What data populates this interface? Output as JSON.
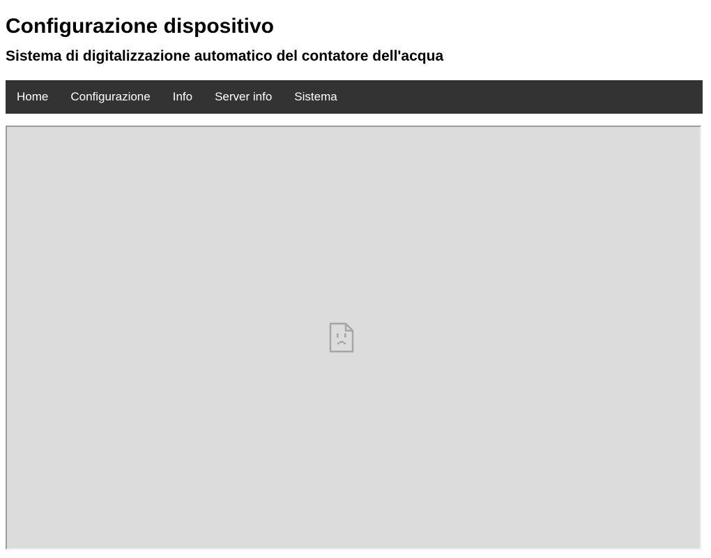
{
  "header": {
    "title": "Configurazione dispositivo",
    "subtitle": "Sistema di digitalizzazione automatico del contatore dell'acqua"
  },
  "nav": {
    "items": [
      {
        "label": "Home"
      },
      {
        "label": "Configurazione"
      },
      {
        "label": "Info"
      },
      {
        "label": "Server info"
      },
      {
        "label": "Sistema"
      }
    ],
    "background": "#333333",
    "text_color": "#ffffff"
  },
  "content": {
    "icon": "broken-page-icon",
    "background": "#dcdcdc"
  }
}
